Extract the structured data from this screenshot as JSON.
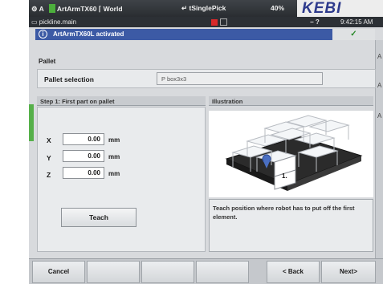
{
  "topbar": {
    "left_text": "A",
    "robot": "ArtArmTX60",
    "world": "World",
    "program": "tSinglePick",
    "percent": "40%",
    "logo": "KEBI"
  },
  "subbar": {
    "file": "pickline.main",
    "icons": "− ?",
    "time": "9:42:15 AM"
  },
  "banner": {
    "icon": "i",
    "message": "ArtArmTX60L activated",
    "ok": "✓"
  },
  "right_strip": [
    "A",
    "A",
    "A"
  ],
  "pallet": {
    "section_title": "Pallet",
    "row_label": "Pallet selection",
    "value": "P box3x3"
  },
  "step": {
    "title": "Step 1: First part on pallet",
    "fields": [
      {
        "label": "X",
        "value": "0.00",
        "unit": "mm"
      },
      {
        "label": "Y",
        "value": "0.00",
        "unit": "mm"
      },
      {
        "label": "Z",
        "value": "0.00",
        "unit": "mm"
      }
    ],
    "teach_label": "Teach"
  },
  "illustration": {
    "title": "Illustration",
    "marker_label": "1.",
    "description": "Teach position where robot has to put off the first element."
  },
  "footer": {
    "cancel": "Cancel",
    "back": "< Back",
    "next": "Next>"
  }
}
